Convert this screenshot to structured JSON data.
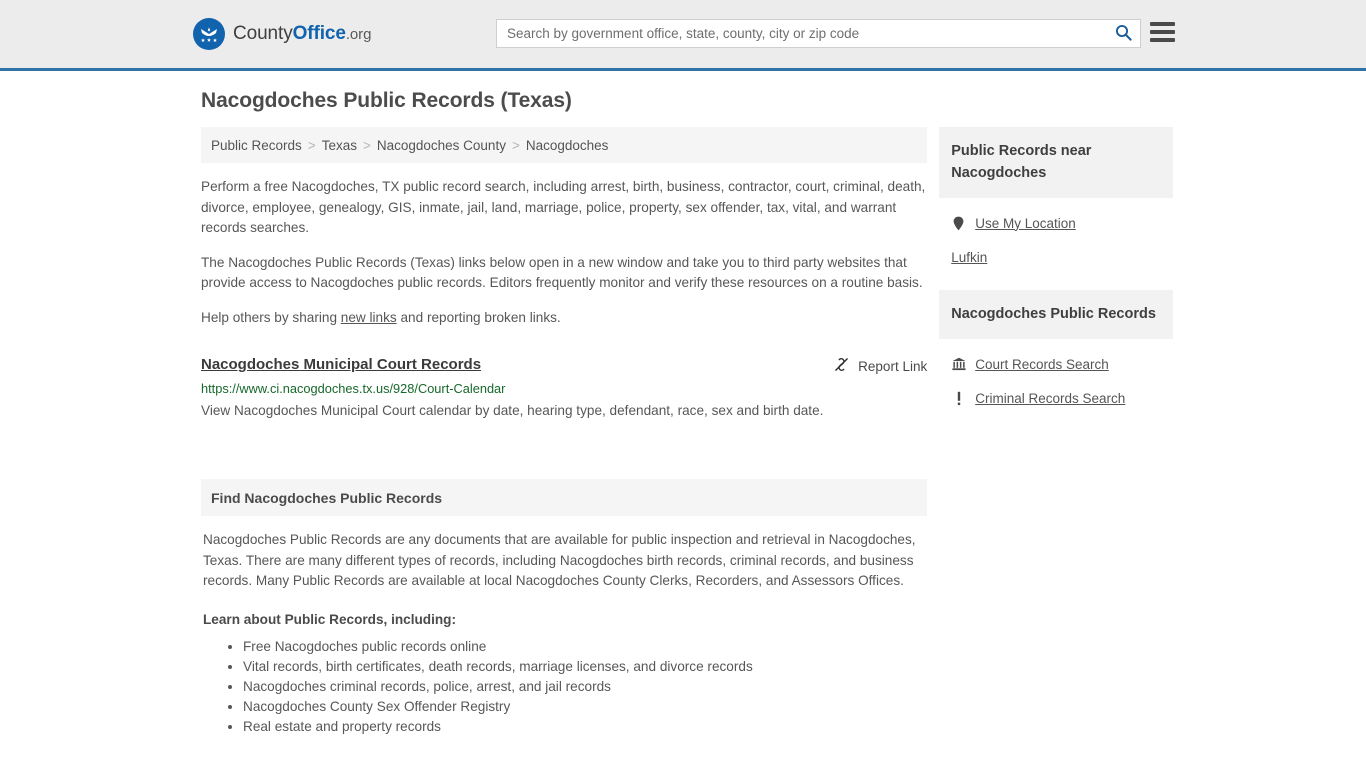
{
  "header": {
    "brand": {
      "part1": "County",
      "part2": "Office",
      "tld": ".org",
      "icon": "eagle-seal-icon"
    },
    "search": {
      "placeholder": "Search by government office, state, county, city or zip code",
      "value": "",
      "button_icon": "search-icon"
    },
    "menu_icon": "hamburger-menu-icon",
    "accent_color": "#3173a6"
  },
  "page": {
    "title": "Nacogdoches Public Records (Texas)"
  },
  "breadcrumb": {
    "separator": ">",
    "items": [
      {
        "label": "Public Records"
      },
      {
        "label": "Texas"
      },
      {
        "label": "Nacogdoches County"
      },
      {
        "label": "Nacogdoches"
      }
    ]
  },
  "intro": {
    "p1": "Perform a free Nacogdoches, TX public record search, including arrest, birth, business, contractor, court, criminal, death, divorce, employee, genealogy, GIS, inmate, jail, land, marriage, police, property, sex offender, tax, vital, and warrant records searches.",
    "p2": "The Nacogdoches Public Records (Texas) links below open in a new window and take you to third party websites that provide access to Nacogdoches public records. Editors frequently monitor and verify these resources on a routine basis.",
    "p3_before": "Help others by sharing ",
    "p3_link": "new links",
    "p3_after": " and reporting broken links."
  },
  "result": {
    "title": "Nacogdoches Municipal Court Records",
    "url": "https://www.ci.nacogdoches.tx.us/928/Court-Calendar",
    "description": "View Nacogdoches Municipal Court calendar by date, hearing type, defendant, race, sex and birth date.",
    "report_label": "Report Link",
    "report_icon": "broken-link-icon",
    "url_color": "#17682b"
  },
  "section": {
    "heading": "Find Nacogdoches Public Records",
    "paragraph": "Nacogdoches Public Records are any documents that are available for public inspection and retrieval in Nacogdoches, Texas. There are many different types of records, including Nacogdoches birth records, criminal records, and business records. Many Public Records are available at local Nacogdoches County Clerks, Recorders, and Assessors Offices.",
    "list_heading": "Learn about Public Records, including:",
    "bullets": [
      "Free Nacogdoches public records online",
      "Vital records, birth certificates, death records, marriage licenses, and divorce records",
      "Nacogdoches criminal records, police, arrest, and jail records",
      "Nacogdoches County Sex Offender Registry",
      "Real estate and property records"
    ]
  },
  "sidebar": {
    "panels": [
      {
        "heading": "Public Records near Nacogdoches",
        "links": [
          {
            "label": "Use My Location",
            "icon": "location-pin-icon"
          },
          {
            "label": "Lufkin",
            "icon": "none"
          }
        ]
      },
      {
        "heading": "Nacogdoches Public Records",
        "links": [
          {
            "label": "Court Records Search",
            "icon": "courthouse-icon"
          },
          {
            "label": "Criminal Records Search",
            "icon": "exclamation-icon"
          }
        ]
      }
    ]
  }
}
